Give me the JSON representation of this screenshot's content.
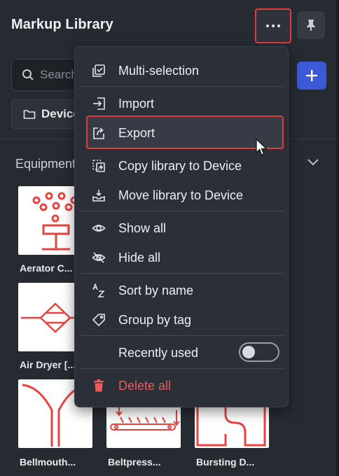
{
  "header": {
    "title": "Markup Library"
  },
  "search": {
    "placeholder": "Search"
  },
  "device_filter": {
    "label": "Device"
  },
  "group": {
    "title": "Equipment"
  },
  "tiles": [
    {
      "label": "Aerator C..."
    },
    {
      "label": "Air Dryer [..."
    },
    {
      "label": "Bellmouth..."
    },
    {
      "label": "Beltpress..."
    },
    {
      "label": "Bursting D..."
    }
  ],
  "menu": {
    "items": [
      {
        "label": "Multi-selection",
        "icon": "multi-select-icon"
      },
      {
        "label": "Import",
        "icon": "import-icon"
      },
      {
        "label": "Export",
        "icon": "export-icon"
      },
      {
        "label": "Copy library to Device",
        "icon": "copy-to-device-icon"
      },
      {
        "label": "Move library to Device",
        "icon": "move-to-device-icon"
      },
      {
        "label": "Show all",
        "icon": "eye-icon"
      },
      {
        "label": "Hide all",
        "icon": "eye-off-icon"
      },
      {
        "label": "Sort by name",
        "icon": "sort-az-icon"
      },
      {
        "label": "Group by tag",
        "icon": "tag-icon"
      },
      {
        "label": "Recently used",
        "toggle_on": false
      },
      {
        "label": "Delete all",
        "icon": "trash-icon"
      }
    ]
  },
  "colors": {
    "accent": "#3c5ad8",
    "highlight": "#e23b3b",
    "danger": "#ef5a5a",
    "symbol": "#e8443f"
  }
}
